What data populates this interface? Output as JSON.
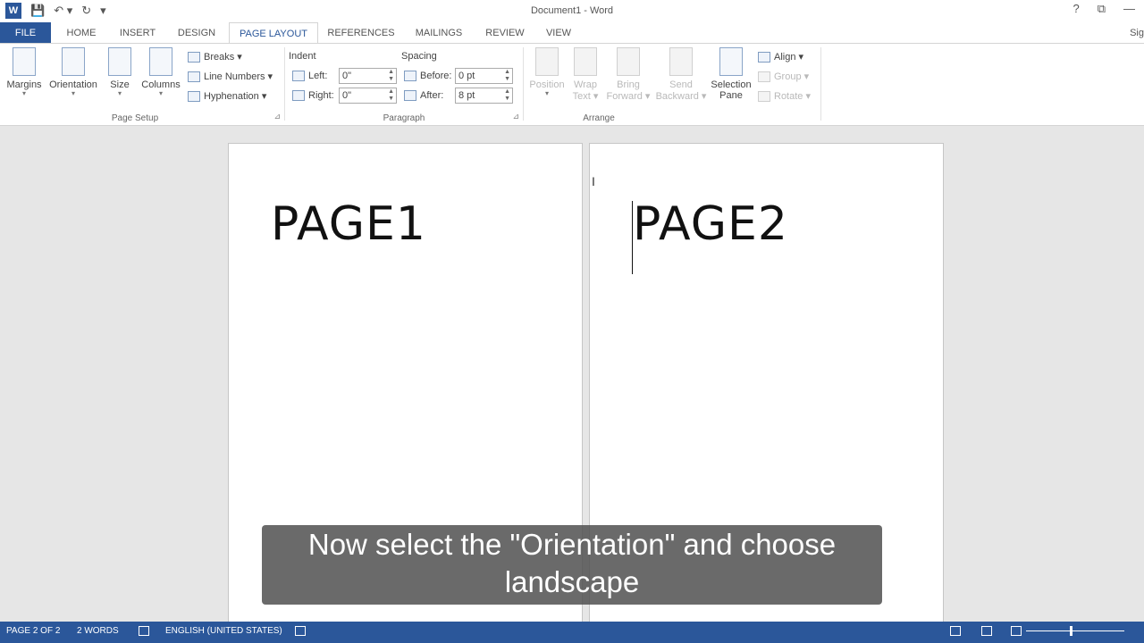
{
  "window": {
    "title": "Document1 - Word",
    "help": "?",
    "restore": "⧉",
    "minimize": "—",
    "app_logo": "W"
  },
  "qat": {
    "save": "💾",
    "undo": "↶ ▾",
    "redo": "↻",
    "customize": "▾"
  },
  "tabs": [
    {
      "label": "FILE"
    },
    {
      "label": "HOME"
    },
    {
      "label": "INSERT"
    },
    {
      "label": "DESIGN"
    },
    {
      "label": "PAGE LAYOUT"
    },
    {
      "label": "REFERENCES"
    },
    {
      "label": "MAILINGS"
    },
    {
      "label": "REVIEW"
    },
    {
      "label": "VIEW"
    }
  ],
  "signin": "Sig",
  "ribbon": {
    "page_setup": {
      "label": "Page Setup",
      "margins": "Margins",
      "orientation": "Orientation",
      "size": "Size",
      "columns": "Columns",
      "breaks": "Breaks ▾",
      "line_numbers": "Line Numbers ▾",
      "hyphenation": "Hyphenation ▾"
    },
    "paragraph": {
      "label": "Paragraph",
      "indent_title": "Indent",
      "spacing_title": "Spacing",
      "left_label": "Left:",
      "left_value": "0\"",
      "right_label": "Right:",
      "right_value": "0\"",
      "before_label": "Before:",
      "before_value": "0 pt",
      "after_label": "After:",
      "after_value": "8 pt"
    },
    "arrange": {
      "label": "Arrange",
      "position": "Position",
      "wrap_text_1": "Wrap",
      "wrap_text_2": "Text ▾",
      "bring_forward_1": "Bring",
      "bring_forward_2": "Forward ▾",
      "send_backward_1": "Send",
      "send_backward_2": "Backward ▾",
      "selection_pane_1": "Selection",
      "selection_pane_2": "Pane",
      "align": "Align ▾",
      "group": "Group ▾",
      "rotate": "Rotate ▾"
    }
  },
  "document": {
    "page1_text": "PAGE1",
    "page2_text": "PAGE2"
  },
  "subtitle": {
    "line1": "Now select the \"Orientation\" and choose",
    "line2": "landscape"
  },
  "statusbar": {
    "page": "PAGE 2 OF 2",
    "words": "2 WORDS",
    "language": "ENGLISH (UNITED STATES)"
  },
  "colors": {
    "accent": "#2b579a"
  }
}
